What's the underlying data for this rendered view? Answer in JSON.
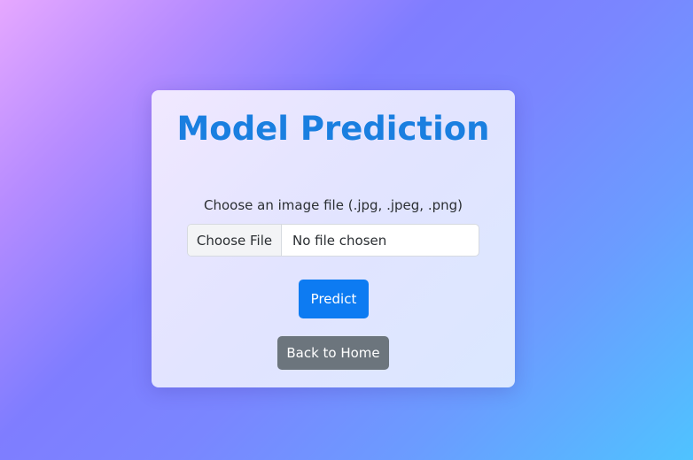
{
  "page": {
    "title": "Model Prediction"
  },
  "form": {
    "file_label": "Choose an image file (.jpg, .jpeg, .png)",
    "choose_file_label": "Choose File",
    "file_status": "No file chosen",
    "predict_label": "Predict",
    "back_label": "Back to Home"
  },
  "colors": {
    "title": "#1a7fe0",
    "primary_button": "#0d7bf2",
    "secondary_button": "#6c757d"
  }
}
